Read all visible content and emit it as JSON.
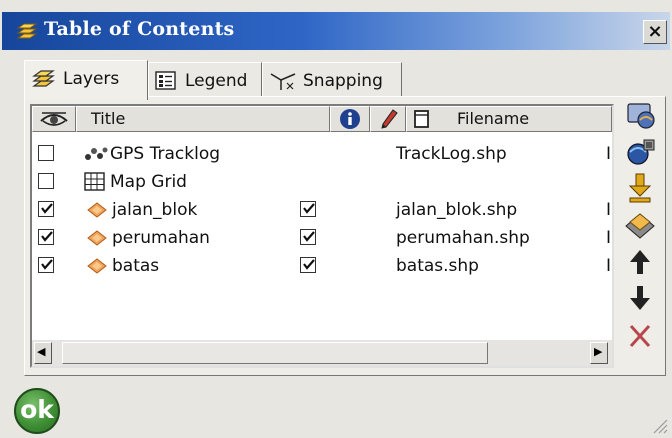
{
  "window": {
    "title": "Table of Contents",
    "close_label": "×"
  },
  "tabs": [
    {
      "label": "Layers",
      "icon": "layers-icon",
      "active": true
    },
    {
      "label": "Legend",
      "icon": "legend-icon",
      "active": false
    },
    {
      "label": "Snapping",
      "icon": "snapping-icon",
      "active": false
    }
  ],
  "table": {
    "columns": [
      {
        "label": "",
        "icon": "eye-icon"
      },
      {
        "label": "Title"
      },
      {
        "label": "",
        "icon": "info-icon"
      },
      {
        "label": "",
        "icon": "pencil-icon"
      },
      {
        "label": "Filename",
        "icon": "file-icon"
      },
      {
        "label": ""
      }
    ],
    "rows": [
      {
        "visible": false,
        "icon": "gps-tracklog-icon",
        "title": "GPS Tracklog",
        "identify": null,
        "filename": "TrackLog.shp",
        "extra": "I"
      },
      {
        "visible": false,
        "icon": "map-grid-icon",
        "title": "Map Grid",
        "identify": null,
        "filename": "",
        "extra": ""
      },
      {
        "visible": true,
        "icon": "shapefile-layer-icon",
        "title": "jalan_blok",
        "identify": true,
        "filename": "jalan_blok.shp",
        "extra": "I"
      },
      {
        "visible": true,
        "icon": "shapefile-layer-icon",
        "title": "perumahan",
        "identify": true,
        "filename": "perumahan.shp",
        "extra": "I"
      },
      {
        "visible": true,
        "icon": "shapefile-layer-icon",
        "title": "batas",
        "identify": true,
        "filename": "batas.shp",
        "extra": "I"
      }
    ]
  },
  "scrollbar": {
    "left_arrow": "◀",
    "right_arrow": "▶"
  },
  "toolbar": [
    {
      "name": "layer-properties-icon"
    },
    {
      "name": "add-layer-icon"
    },
    {
      "name": "move-down-layer-icon"
    },
    {
      "name": "remove-layer-icon"
    },
    {
      "name": "move-up-icon"
    },
    {
      "name": "move-down-icon"
    },
    {
      "name": "delete-icon"
    }
  ],
  "ok_label": "ok",
  "colors": {
    "titlebar_start": "#16469b",
    "titlebar_end": "#c9d6ea",
    "ok_green": "#3f8f35",
    "delete_red": "#b7474b"
  }
}
